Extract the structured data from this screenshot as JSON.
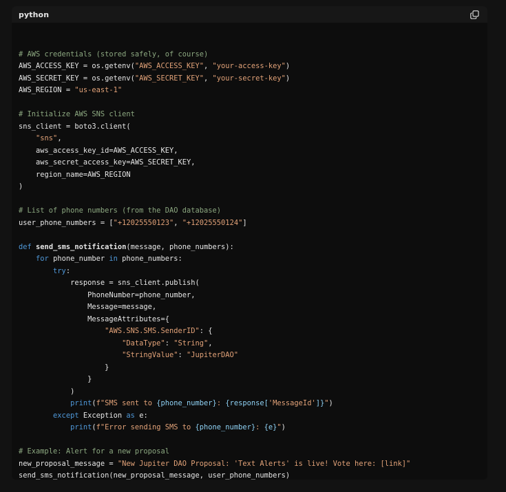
{
  "header": {
    "language": "python",
    "copy_icon": "copy-icon"
  },
  "colors": {
    "background": "#0d0d0d",
    "header": "#171717",
    "comment": "#8ca880",
    "string": "#e2a278",
    "keyword": "#4f98d9",
    "text": "#e6e6e6"
  },
  "code_lines": [
    [],
    [
      {
        "t": "# AWS credentials (stored safely, of course)",
        "c": "comment"
      }
    ],
    [
      {
        "t": "AWS_ACCESS_KEY = os.getenv(",
        "c": "plain"
      },
      {
        "t": "\"AWS_ACCESS_KEY\"",
        "c": "string"
      },
      {
        "t": ", ",
        "c": "plain"
      },
      {
        "t": "\"your-access-key\"",
        "c": "string"
      },
      {
        "t": ")",
        "c": "plain"
      }
    ],
    [
      {
        "t": "AWS_SECRET_KEY = os.getenv(",
        "c": "plain"
      },
      {
        "t": "\"AWS_SECRET_KEY\"",
        "c": "string"
      },
      {
        "t": ", ",
        "c": "plain"
      },
      {
        "t": "\"your-secret-key\"",
        "c": "string"
      },
      {
        "t": ")",
        "c": "plain"
      }
    ],
    [
      {
        "t": "AWS_REGION = ",
        "c": "plain"
      },
      {
        "t": "\"us-east-1\"",
        "c": "string"
      }
    ],
    [],
    [
      {
        "t": "# Initialize AWS SNS client",
        "c": "comment"
      }
    ],
    [
      {
        "t": "sns_client = boto3.client(",
        "c": "plain"
      }
    ],
    [
      {
        "t": "    ",
        "c": "plain"
      },
      {
        "t": "\"sns\"",
        "c": "string"
      },
      {
        "t": ",",
        "c": "plain"
      }
    ],
    [
      {
        "t": "    aws_access_key_id=AWS_ACCESS_KEY,",
        "c": "plain"
      }
    ],
    [
      {
        "t": "    aws_secret_access_key=AWS_SECRET_KEY,",
        "c": "plain"
      }
    ],
    [
      {
        "t": "    region_name=AWS_REGION",
        "c": "plain"
      }
    ],
    [
      {
        "t": ")",
        "c": "plain"
      }
    ],
    [],
    [
      {
        "t": "# List of phone numbers (from the DAO database)",
        "c": "comment"
      }
    ],
    [
      {
        "t": "user_phone_numbers = [",
        "c": "plain"
      },
      {
        "t": "\"+12025550123\"",
        "c": "string"
      },
      {
        "t": ", ",
        "c": "plain"
      },
      {
        "t": "\"+12025550124\"",
        "c": "string"
      },
      {
        "t": "]",
        "c": "plain"
      }
    ],
    [],
    [
      {
        "t": "def",
        "c": "keyword"
      },
      {
        "t": " ",
        "c": "plain"
      },
      {
        "t": "send_sms_notification",
        "c": "func"
      },
      {
        "t": "(message, phone_numbers):",
        "c": "plain"
      }
    ],
    [
      {
        "t": "    ",
        "c": "plain"
      },
      {
        "t": "for",
        "c": "keyword"
      },
      {
        "t": " phone_number ",
        "c": "plain"
      },
      {
        "t": "in",
        "c": "keyword"
      },
      {
        "t": " phone_numbers:",
        "c": "plain"
      }
    ],
    [
      {
        "t": "        ",
        "c": "plain"
      },
      {
        "t": "try",
        "c": "keyword"
      },
      {
        "t": ":",
        "c": "plain"
      }
    ],
    [
      {
        "t": "            response = sns_client.publish(",
        "c": "plain"
      }
    ],
    [
      {
        "t": "                PhoneNumber=phone_number,",
        "c": "plain"
      }
    ],
    [
      {
        "t": "                Message=message,",
        "c": "plain"
      }
    ],
    [
      {
        "t": "                MessageAttributes={",
        "c": "plain"
      }
    ],
    [
      {
        "t": "                    ",
        "c": "plain"
      },
      {
        "t": "\"AWS.SNS.SMS.SenderID\"",
        "c": "string"
      },
      {
        "t": ": {",
        "c": "plain"
      }
    ],
    [
      {
        "t": "                        ",
        "c": "plain"
      },
      {
        "t": "\"DataType\"",
        "c": "string"
      },
      {
        "t": ": ",
        "c": "plain"
      },
      {
        "t": "\"String\"",
        "c": "string"
      },
      {
        "t": ",",
        "c": "plain"
      }
    ],
    [
      {
        "t": "                        ",
        "c": "plain"
      },
      {
        "t": "\"StringValue\"",
        "c": "string"
      },
      {
        "t": ": ",
        "c": "plain"
      },
      {
        "t": "\"JupiterDAO\"",
        "c": "string"
      }
    ],
    [
      {
        "t": "                    }",
        "c": "plain"
      }
    ],
    [
      {
        "t": "                }",
        "c": "plain"
      }
    ],
    [
      {
        "t": "            )",
        "c": "plain"
      }
    ],
    [
      {
        "t": "            ",
        "c": "plain"
      },
      {
        "t": "print",
        "c": "builtin"
      },
      {
        "t": "(",
        "c": "plain"
      },
      {
        "t": "f\"SMS sent to ",
        "c": "string"
      },
      {
        "t": "{phone_number}",
        "c": "interp"
      },
      {
        "t": ": ",
        "c": "string"
      },
      {
        "t": "{response[",
        "c": "interp"
      },
      {
        "t": "'MessageId'",
        "c": "string"
      },
      {
        "t": "]}",
        "c": "interp"
      },
      {
        "t": "\"",
        "c": "string"
      },
      {
        "t": ")",
        "c": "plain"
      }
    ],
    [
      {
        "t": "        ",
        "c": "plain"
      },
      {
        "t": "except",
        "c": "keyword"
      },
      {
        "t": " Exception ",
        "c": "plain"
      },
      {
        "t": "as",
        "c": "keyword"
      },
      {
        "t": " e:",
        "c": "plain"
      }
    ],
    [
      {
        "t": "            ",
        "c": "plain"
      },
      {
        "t": "print",
        "c": "builtin"
      },
      {
        "t": "(",
        "c": "plain"
      },
      {
        "t": "f\"Error sending SMS to ",
        "c": "string"
      },
      {
        "t": "{phone_number}",
        "c": "interp"
      },
      {
        "t": ": ",
        "c": "string"
      },
      {
        "t": "{e}",
        "c": "interp"
      },
      {
        "t": "\"",
        "c": "string"
      },
      {
        "t": ")",
        "c": "plain"
      }
    ],
    [],
    [
      {
        "t": "# Example: Alert for a new proposal",
        "c": "comment"
      }
    ],
    [
      {
        "t": "new_proposal_message = ",
        "c": "plain"
      },
      {
        "t": "\"New Jupiter DAO Proposal: 'Text Alerts' is live! Vote here: [link]\"",
        "c": "string"
      }
    ],
    [
      {
        "t": "send_sms_notification(new_proposal_message, user_phone_numbers)",
        "c": "plain"
      }
    ]
  ]
}
